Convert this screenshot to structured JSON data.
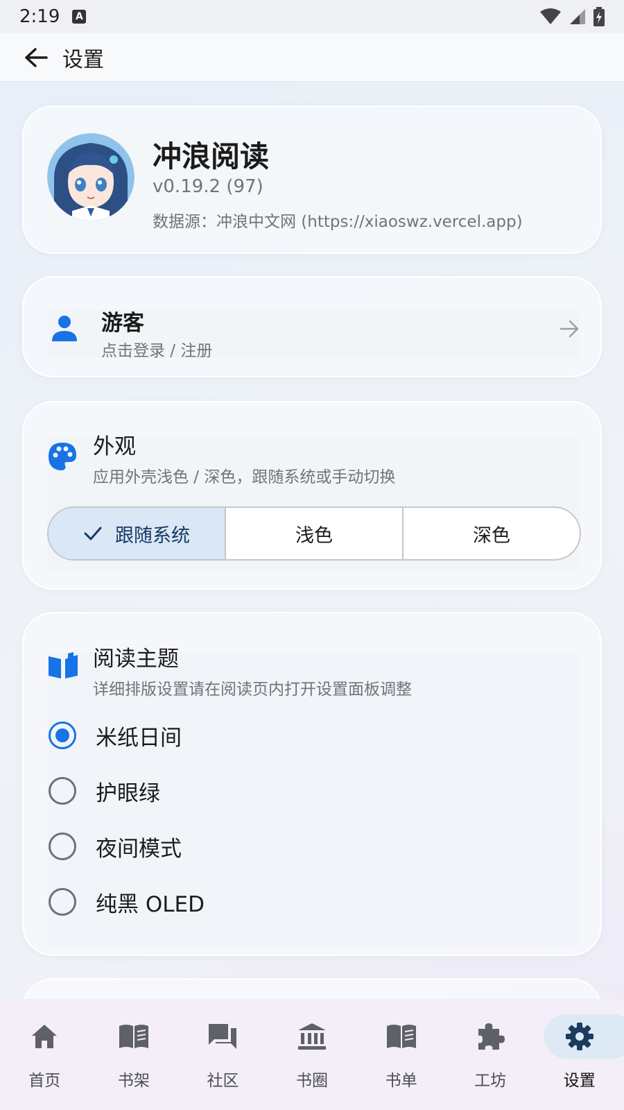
{
  "status_bar": {
    "time": "2:19",
    "indicator": "A"
  },
  "app_bar": {
    "title": "设置"
  },
  "profile": {
    "app_name": "冲浪阅读",
    "version": "v0.19.2 (97)",
    "source": "数据源：冲浪中文网 (https://xiaoswz.vercel.app)"
  },
  "user": {
    "name": "游客",
    "subtitle": "点击登录 / 注册"
  },
  "appearance": {
    "title": "外观",
    "subtitle": "应用外壳浅色 / 深色，跟随系统或手动切换",
    "options": [
      "跟随系统",
      "浅色",
      "深色"
    ],
    "selected": "跟随系统"
  },
  "reading_theme": {
    "title": "阅读主题",
    "subtitle": "详细排版设置请在阅读页内打开设置面板调整",
    "options": [
      "米纸日间",
      "护眼绿",
      "夜间模式",
      "纯黑 OLED"
    ],
    "selected": "米纸日间"
  },
  "bottom_nav": {
    "items": [
      "首页",
      "书架",
      "社区",
      "书圈",
      "书单",
      "工坊",
      "设置"
    ],
    "active": "设置"
  },
  "colors": {
    "accent": "#1773e6",
    "icon_gray": "#5e6166"
  }
}
